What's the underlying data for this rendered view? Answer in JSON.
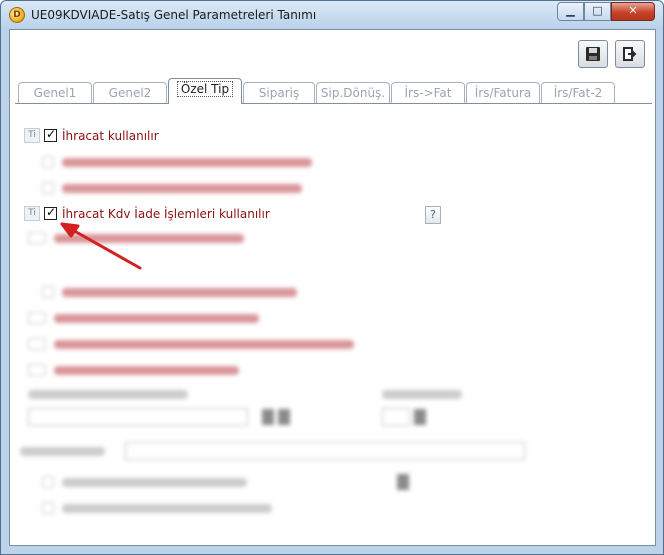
{
  "window": {
    "title": "UE09KDVIADE-Satış Genel Parametreleri Tanımı",
    "app_icon": "D"
  },
  "caption_buttons": {
    "minimize": "▁",
    "maximize": "□",
    "close": "✕"
  },
  "toolbar": {
    "save_icon": "floppy-disk-icon",
    "exit_icon": "exit-door-icon"
  },
  "tabs": [
    {
      "label": "Genel1"
    },
    {
      "label": "Genel2"
    },
    {
      "label": "Özel Tip",
      "active": true
    },
    {
      "label": "Sipariş"
    },
    {
      "label": "Sip.Dönüş."
    },
    {
      "label": "İrs->Fat"
    },
    {
      "label": "İrs/Fatura"
    },
    {
      "label": "İrs/Fat-2"
    }
  ],
  "options": {
    "ihracat": {
      "label": "İhracat kullanılır",
      "checked": true,
      "icon_text": "Ti"
    },
    "ihracat_kdv": {
      "label": "İhracat Kdv İade İşlemleri kullanılır",
      "checked": true,
      "icon_text": "Ti"
    }
  },
  "help_button": {
    "label": "?"
  },
  "colors": {
    "label_red": "#8a1212",
    "arrow_red": "#d42020",
    "window_frame": "#bcd3ea",
    "close_button": "#c7432a"
  }
}
